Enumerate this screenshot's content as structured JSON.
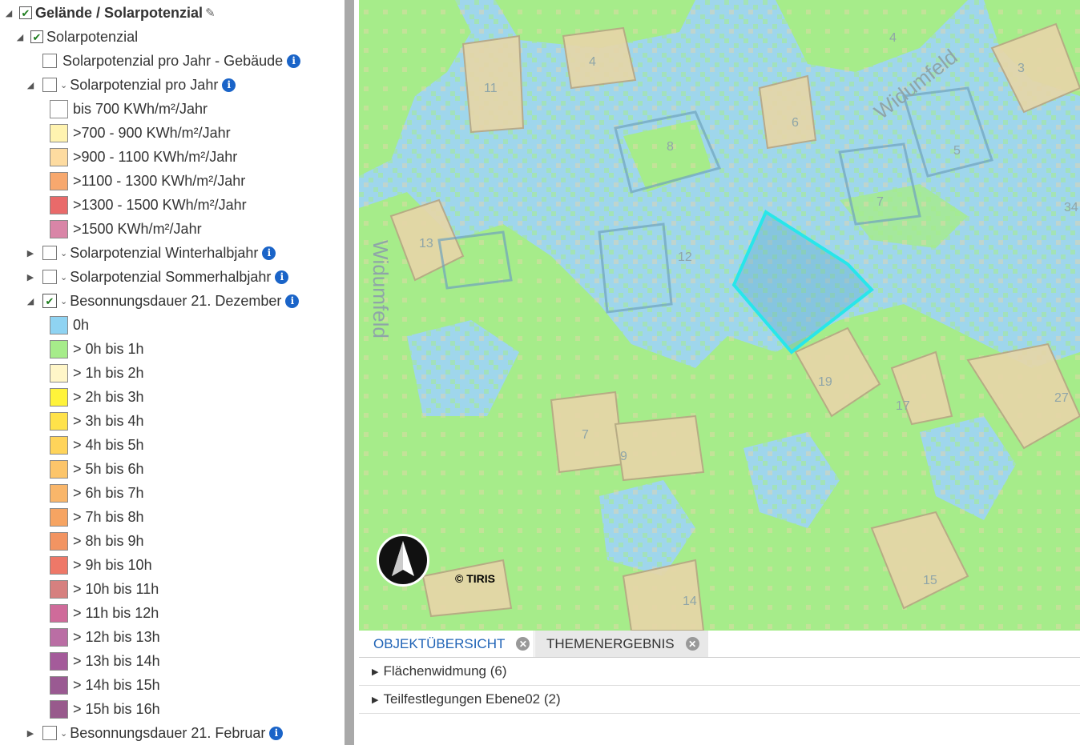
{
  "tree": {
    "root": {
      "label": "Gelände / Solarpotenzial",
      "checked": true
    },
    "solar": {
      "label": "Solarpotenzial",
      "checked": true
    },
    "solar_gebaeude": {
      "label": "Solarpotenzial pro Jahr - Gebäude"
    },
    "solar_jahr": {
      "label": "Solarpotenzial pro Jahr"
    },
    "solar_legend": [
      {
        "label": "bis 700 KWh/m²/Jahr",
        "color": "#ffffff"
      },
      {
        "label": ">700 - 900 KWh/m²/Jahr",
        "color": "#fff3b0"
      },
      {
        "label": ">900 - 1100 KWh/m²/Jahr",
        "color": "#fddba0"
      },
      {
        "label": ">1100 - 1300 KWh/m²/Jahr",
        "color": "#f7a86e"
      },
      {
        "label": ">1300 - 1500 KWh/m²/Jahr",
        "color": "#e96a6a"
      },
      {
        "label": ">1500 KWh/m²/Jahr",
        "color": "#d985a7"
      }
    ],
    "winter": {
      "label": "Solarpotenzial Winterhalbjahr"
    },
    "sommer": {
      "label": "Solarpotenzial Sommerhalbjahr"
    },
    "dezember": {
      "label": "Besonnungsdauer 21. Dezember",
      "checked": true
    },
    "dez_legend": [
      {
        "label": "0h",
        "color": "#8fd3f2"
      },
      {
        "label": "> 0h bis 1h",
        "color": "#a6ec8a"
      },
      {
        "label": "> 1h bis 2h",
        "color": "#fff6c8"
      },
      {
        "label": "> 2h bis 3h",
        "color": "#fff33a"
      },
      {
        "label": "> 3h bis 4h",
        "color": "#ffe24a"
      },
      {
        "label": "> 4h bis 5h",
        "color": "#ffd45a"
      },
      {
        "label": "> 5h bis 6h",
        "color": "#fcc56a"
      },
      {
        "label": "> 6h bis 7h",
        "color": "#f9b66a"
      },
      {
        "label": "> 7h bis 8h",
        "color": "#f6a462"
      },
      {
        "label": "> 8h bis 9h",
        "color": "#f29462"
      },
      {
        "label": "> 9h bis 10h",
        "color": "#ee7868"
      },
      {
        "label": "> 10h bis 11h",
        "color": "#d6807f"
      },
      {
        "label": "> 11h bis 12h",
        "color": "#cf6b9a"
      },
      {
        "label": "> 12h bis 13h",
        "color": "#ba6ea4"
      },
      {
        "label": "> 13h bis 14h",
        "color": "#a45b9a"
      },
      {
        "label": "> 14h bis 15h",
        "color": "#9a5a92"
      },
      {
        "label": "> 15h bis 16h",
        "color": "#985a8c"
      }
    ],
    "februar": {
      "label": "Besonnungsdauer 21. Februar"
    }
  },
  "map": {
    "street_labels": [
      "Widumfeld",
      "Widumfeld"
    ],
    "house_numbers": [
      "11",
      "4",
      "4",
      "3",
      "6",
      "8",
      "5",
      "7",
      "34",
      "13",
      "12",
      "19",
      "17",
      "27",
      "7",
      "9",
      "14",
      "15"
    ],
    "copyright": "© TIRIS",
    "colors": {
      "zero_h": "#9fd6ec",
      "one_h": "#a6ec8a",
      "building": "#e6d6a8",
      "selection": "#28e6ea"
    }
  },
  "bottom": {
    "tabs": [
      {
        "label": "OBJEKTÜBERSICHT",
        "active": true
      },
      {
        "label": "THEMENERGEBNIS",
        "active": false
      }
    ],
    "results": [
      "Flächenwidmung (6)",
      "Teilfestlegungen Ebene02 (2)"
    ]
  }
}
